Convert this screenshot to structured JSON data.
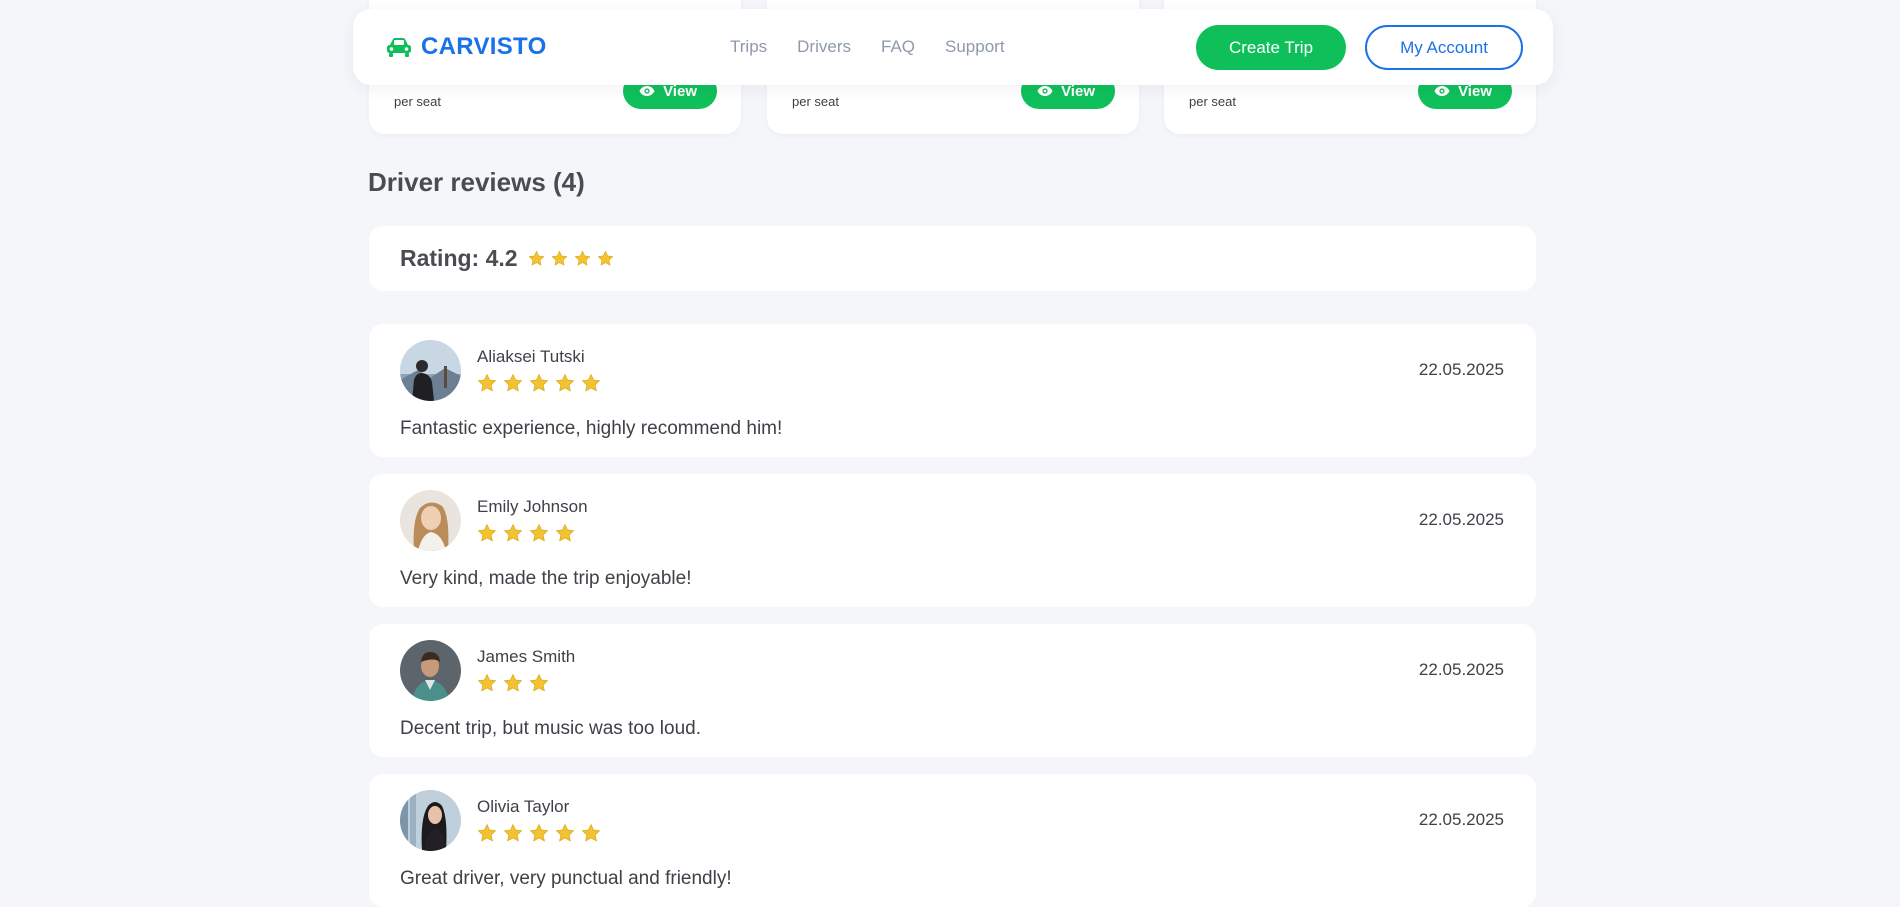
{
  "header": {
    "logo_text": "CARVISTO",
    "nav": [
      "Trips",
      "Drivers",
      "FAQ",
      "Support"
    ],
    "create_trip": "Create Trip",
    "my_account": "My Account"
  },
  "trip_cards": [
    {
      "price_unit": "per seat",
      "view_label": "View"
    },
    {
      "price_unit": "per seat",
      "view_label": "View"
    },
    {
      "price_unit": "per seat",
      "view_label": "View"
    }
  ],
  "reviews_section": {
    "title": "Driver reviews (4)",
    "rating_label": "Rating: 4.2",
    "rating_stars_shown": 4
  },
  "reviews": [
    {
      "name": "Aliaksei Tutski",
      "stars": 5,
      "date": "22.05.2025",
      "text": "Fantastic experience, highly recommend him!"
    },
    {
      "name": "Emily Johnson",
      "stars": 4,
      "date": "22.05.2025",
      "text": "Very kind, made the trip enjoyable!"
    },
    {
      "name": "James Smith",
      "stars": 3,
      "date": "22.05.2025",
      "text": "Decent trip, but music was too loud."
    },
    {
      "name": "Olivia Taylor",
      "stars": 5,
      "date": "22.05.2025",
      "text": "Great driver, very punctual and friendly!"
    }
  ],
  "colors": {
    "brand_blue": "#1a72e8",
    "primary_green": "#0fc05a",
    "star_gold": "#f2c230",
    "page_bg": "#f4f6fa"
  }
}
